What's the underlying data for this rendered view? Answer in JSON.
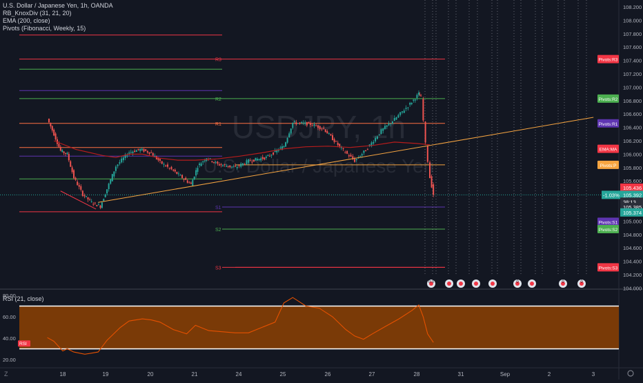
{
  "legend": {
    "symbol": "U.S. Dollar / Japanese Yen, 1h, OANDA",
    "indicators": [
      "RB_KnoxDiv (31, 21, 20)",
      "EMA (200, close)",
      "Pivots (Fibonacci, Weekly, 15)"
    ]
  },
  "watermark": {
    "ticker": "USDJPY, 1h",
    "name": "U.S. Dollar / Japanese Yen"
  },
  "rsi_legend": "RSI (21, close)",
  "colors": {
    "background": "#131722",
    "up": "#26a69a",
    "down": "#ef5350",
    "ema": "#b71c1c",
    "trendline": "#f7a541",
    "rsi_band": "#7a3a07",
    "rsi_line": "#e65100"
  },
  "chart_data": [
    {
      "type": "candlestick",
      "title": "U.S. Dollar / Japanese Yen, 1h, OANDA",
      "x_ticks": [
        "18",
        "19",
        "20",
        "21",
        "24",
        "25",
        "26",
        "27",
        "28",
        "31",
        "Sep",
        "2",
        "3"
      ],
      "y_ticks": [
        "108.200",
        "108.000",
        "107.800",
        "107.600",
        "107.400",
        "107.200",
        "107.000",
        "106.800",
        "106.600",
        "106.400",
        "106.200",
        "106.000",
        "105.800",
        "105.600",
        "105.400",
        "105.200",
        "105.000",
        "104.800",
        "104.600",
        "104.400",
        "104.200",
        "104.000"
      ],
      "ylim": [
        104.0,
        108.2
      ],
      "price_path": [
        [
          17.65,
          106.53
        ],
        [
          17.8,
          106.3
        ],
        [
          17.95,
          106.05
        ],
        [
          18.1,
          106.0
        ],
        [
          18.25,
          105.65
        ],
        [
          18.45,
          105.4
        ],
        [
          18.65,
          105.28
        ],
        [
          18.85,
          105.22
        ],
        [
          19.0,
          105.48
        ],
        [
          19.2,
          105.82
        ],
        [
          19.5,
          106.03
        ],
        [
          19.75,
          106.07
        ],
        [
          20.0,
          106.02
        ],
        [
          20.2,
          105.88
        ],
        [
          20.5,
          105.75
        ],
        [
          20.9,
          105.55
        ],
        [
          21.05,
          105.82
        ],
        [
          21.25,
          105.95
        ],
        [
          21.5,
          105.85
        ],
        [
          21.9,
          105.8
        ],
        [
          22.2,
          105.9
        ],
        [
          22.6,
          105.95
        ],
        [
          23.0,
          106.12
        ],
        [
          23.2,
          106.47
        ],
        [
          23.6,
          106.45
        ],
        [
          23.9,
          106.38
        ],
        [
          24.3,
          106.08
        ],
        [
          24.6,
          105.9
        ],
        [
          24.85,
          106.06
        ],
        [
          25.2,
          106.35
        ],
        [
          25.5,
          106.52
        ],
        [
          25.85,
          106.75
        ],
        [
          26.05,
          106.9
        ],
        [
          26.1,
          106.85
        ],
        [
          26.2,
          106.15
        ],
        [
          26.3,
          105.65
        ],
        [
          26.38,
          105.4
        ]
      ],
      "ema_path": [
        [
          17.8,
          106.2
        ],
        [
          18.3,
          106.07
        ],
        [
          18.9,
          105.98
        ],
        [
          19.2,
          105.95
        ],
        [
          19.5,
          106.0
        ],
        [
          19.8,
          106.0
        ],
        [
          20.2,
          105.94
        ],
        [
          20.6,
          105.91
        ],
        [
          21.0,
          105.91
        ],
        [
          21.5,
          105.93
        ],
        [
          22.0,
          105.97
        ],
        [
          22.5,
          106.02
        ],
        [
          23.0,
          106.08
        ],
        [
          23.5,
          106.11
        ],
        [
          24.0,
          106.12
        ],
        [
          24.5,
          106.1
        ],
        [
          25.0,
          106.13
        ],
        [
          25.5,
          106.18
        ],
        [
          26.0,
          106.16
        ],
        [
          26.3,
          106.14
        ]
      ],
      "trendline": [
        [
          18.8,
          105.28
        ],
        [
          30.0,
          106.55
        ]
      ],
      "knox_div_line": [
        [
          17.95,
          105.45
        ],
        [
          18.75,
          105.18
        ]
      ],
      "pivot_levels": [
        {
          "label": "R3",
          "value": 107.42,
          "color": "#f23645",
          "start": 17.0
        },
        {
          "label": "R2",
          "value": 106.83,
          "color": "#4caf50",
          "start": 17.0
        },
        {
          "label": "R1",
          "value": 106.46,
          "color": "#ff7043",
          "start": 17.0
        },
        {
          "label": "S1",
          "value": 105.21,
          "color": "#5e35b1",
          "start": 21.9
        },
        {
          "label": "S2",
          "value": 104.88,
          "color": "#4caf50",
          "start": 21.9
        },
        {
          "label": "S3",
          "value": 104.31,
          "color": "#f23645",
          "start": 21.9
        },
        {
          "label": "",
          "value": 107.78,
          "color": "#f23645",
          "start": 17.0
        },
        {
          "label": "",
          "value": 107.27,
          "color": "#4caf50",
          "start": 17.0
        },
        {
          "label": "",
          "value": 106.95,
          "color": "#5e35b1",
          "start": 17.0
        },
        {
          "label": "",
          "value": 106.1,
          "color": "#ff7043",
          "start": 17.0
        },
        {
          "label": "",
          "value": 105.97,
          "color": "#5e35b1",
          "start": 17.0
        },
        {
          "label": "",
          "value": 105.63,
          "color": "#4caf50",
          "start": 17.0
        },
        {
          "label": "",
          "value": 105.14,
          "color": "#f23645",
          "start": 17.0
        },
        {
          "label": "",
          "value": 105.84,
          "color": "#f7a541",
          "start": 21.9
        }
      ],
      "last_price": 105.392,
      "last_price_line": 105.436,
      "right_labels": [
        {
          "text": "Pivots:R3",
          "value": 107.42,
          "bg": "#f23645"
        },
        {
          "text": "Pivots:R2",
          "value": 106.83,
          "bg": "#4caf50"
        },
        {
          "text": "Pivots:R1",
          "value": 106.46,
          "bg": "#5e35b1"
        },
        {
          "text": "EMA:MA",
          "value": 106.08,
          "bg": "#f23645"
        },
        {
          "text": "Pivots:P",
          "value": 105.84,
          "bg": "#f7a541"
        },
        {
          "text": "Pivots:S1",
          "value": 104.99,
          "bg": "#5e35b1"
        },
        {
          "text": "Pivots:S2",
          "value": 104.88,
          "bg": "#4caf50"
        },
        {
          "text": "Pivots:S3",
          "value": 104.31,
          "bg": "#f23645"
        }
      ],
      "axis_tags": [
        {
          "text": "105.436",
          "value": 105.5,
          "bg": "#f23645"
        },
        {
          "text": "-1.03%",
          "value": 105.392,
          "bg": "#26a69a",
          "pair": "105.392"
        },
        {
          "text": "38:13",
          "value": 105.29,
          "bg": "#2a2e39"
        },
        {
          "text": "105.385",
          "value": 105.21,
          "bg": "#2a2e39"
        },
        {
          "text": "105.374",
          "value": 105.13,
          "bg": "#26a69a"
        }
      ],
      "events": [
        {
          "label": "0:0",
          "x": 26.35
        },
        {
          "label": "",
          "x": 26.7
        },
        {
          "label": "",
          "x": 26.95
        },
        {
          "label": "",
          "x": 27.3
        },
        {
          "label": "",
          "x": 27.6
        },
        {
          "label": "0",
          "x": 28.2
        },
        {
          "label": "",
          "x": 28.45
        },
        {
          "label": "0",
          "x": 29.3
        },
        {
          "label": "0",
          "x": 29.55
        }
      ]
    },
    {
      "type": "line",
      "title": "RSI (21, close)",
      "y_ticks": [
        "80.00",
        "60.00",
        "40.00",
        "20.00"
      ],
      "ylim": [
        17,
        82
      ],
      "band": [
        30,
        70
      ],
      "rsi_tag": "RSI",
      "x": [
        17.65,
        17.8,
        18.0,
        18.1,
        18.25,
        18.5,
        18.8,
        19.0,
        19.3,
        19.5,
        19.8,
        20.0,
        20.2,
        20.5,
        20.8,
        21.0,
        21.3,
        21.6,
        21.9,
        22.2,
        22.5,
        22.8,
        23.0,
        23.2,
        23.5,
        23.8,
        24.1,
        24.4,
        24.6,
        24.8,
        25.0,
        25.3,
        25.6,
        25.9,
        26.05,
        26.15,
        26.25,
        26.38
      ],
      "values": [
        40.5,
        37,
        28,
        30,
        27,
        25,
        27,
        38,
        50,
        56,
        58,
        57,
        55,
        48,
        44,
        52,
        47,
        46,
        45,
        45,
        50,
        55,
        73,
        78,
        70,
        68,
        60,
        48,
        42,
        39,
        44,
        51,
        58,
        66,
        71,
        60,
        44,
        36
      ]
    }
  ]
}
